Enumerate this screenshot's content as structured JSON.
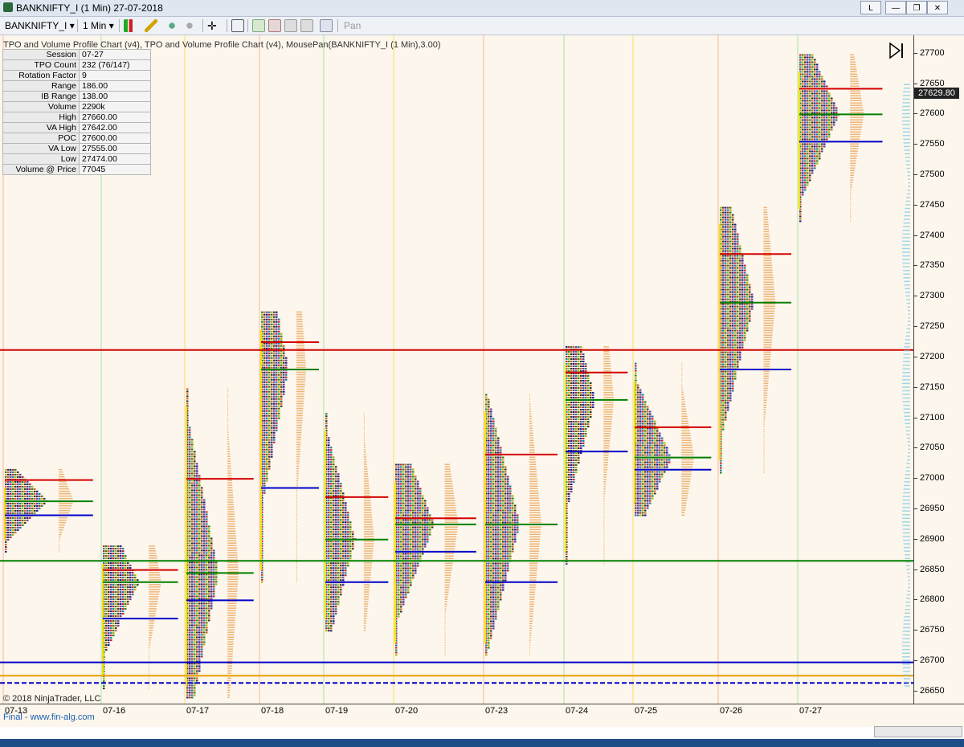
{
  "window": {
    "title": "BANKNIFTY_I (1 Min)  27-07-2018",
    "controls": [
      "L",
      "—",
      "❐",
      "✕"
    ]
  },
  "toolbar": {
    "instrument": "BANKNIFTY_I",
    "interval": "1 Min",
    "pan_label": "Pan"
  },
  "chart": {
    "caption": "TPO and Volume Profile Chart (v4),  TPO and Volume Profile Chart (v4), MousePan(BANKNIFTY_I (1 Min),3.00)",
    "copyright": "© 2018 NinjaTrader, LLC",
    "footer": "Final - www.fin-alg.com",
    "current_price": "27629.80",
    "stats": [
      {
        "k": "Session",
        "v": "07-27"
      },
      {
        "k": "TPO Count",
        "v": "232 (76/147)"
      },
      {
        "k": "Rotation Factor",
        "v": "9"
      },
      {
        "k": "Range",
        "v": "186.00"
      },
      {
        "k": "IB Range",
        "v": "138.00"
      },
      {
        "k": "Volume",
        "v": "2290k"
      },
      {
        "k": "High",
        "v": "27660.00"
      },
      {
        "k": "VA High",
        "v": "27642.00"
      },
      {
        "k": "POC",
        "v": "27600.00"
      },
      {
        "k": "VA Low",
        "v": "27555.00"
      },
      {
        "k": "Low",
        "v": "27474.00"
      },
      {
        "k": "Volume @ Price",
        "v": "77045"
      }
    ],
    "colors": {
      "background": "#fdf6ec",
      "poc": "#008000",
      "va_high": "#d40000",
      "va_low": "#0000c8",
      "ib": "#f5e000",
      "volume": "#e8a55a"
    }
  },
  "chart_data": {
    "type": "tpo_profile",
    "y_ticks": [
      27700,
      27650,
      27600,
      27550,
      27500,
      27450,
      27400,
      27350,
      27300,
      27250,
      27200,
      27150,
      27100,
      27050,
      27000,
      26950,
      26900,
      26850,
      26800,
      26750,
      26700,
      26650
    ],
    "ylim": [
      26630,
      27730
    ],
    "x_labels": [
      "07-13",
      "07-16",
      "07-17",
      "07-18",
      "07-19",
      "07-20",
      "07-23",
      "07-24",
      "07-25",
      "07-26",
      "07-27"
    ],
    "sessions": [
      {
        "date": "07-13",
        "high": 26975,
        "low": 26930,
        "poc": 26963,
        "vah": 26998,
        "val": 26940
      },
      {
        "date": "07-16",
        "high": 26850,
        "low": 26705,
        "poc": 26830,
        "vah": 26850,
        "val": 26770
      },
      {
        "date": "07-17",
        "high": 27110,
        "low": 26690,
        "poc": 26845,
        "vah": 27000,
        "val": 26800
      },
      {
        "date": "07-18",
        "high": 27235,
        "low": 26880,
        "poc": 27180,
        "vah": 27225,
        "val": 26985
      },
      {
        "date": "07-19",
        "high": 27070,
        "low": 26800,
        "poc": 26900,
        "vah": 26970,
        "val": 26830
      },
      {
        "date": "07-20",
        "high": 26985,
        "low": 26760,
        "poc": 26925,
        "vah": 26935,
        "val": 26880
      },
      {
        "date": "07-23",
        "high": 27100,
        "low": 26760,
        "poc": 26925,
        "vah": 27040,
        "val": 26830
      },
      {
        "date": "07-24",
        "high": 27180,
        "low": 26910,
        "poc": 27130,
        "vah": 27175,
        "val": 27045
      },
      {
        "date": "07-25",
        "high": 27150,
        "low": 26990,
        "poc": 27035,
        "vah": 27085,
        "val": 27015
      },
      {
        "date": "07-26",
        "high": 27410,
        "low": 27060,
        "poc": 27290,
        "vah": 27370,
        "val": 27180
      },
      {
        "date": "07-27",
        "high": 27660,
        "low": 27474,
        "poc": 27600,
        "vah": 27642,
        "val": 27555
      }
    ]
  }
}
